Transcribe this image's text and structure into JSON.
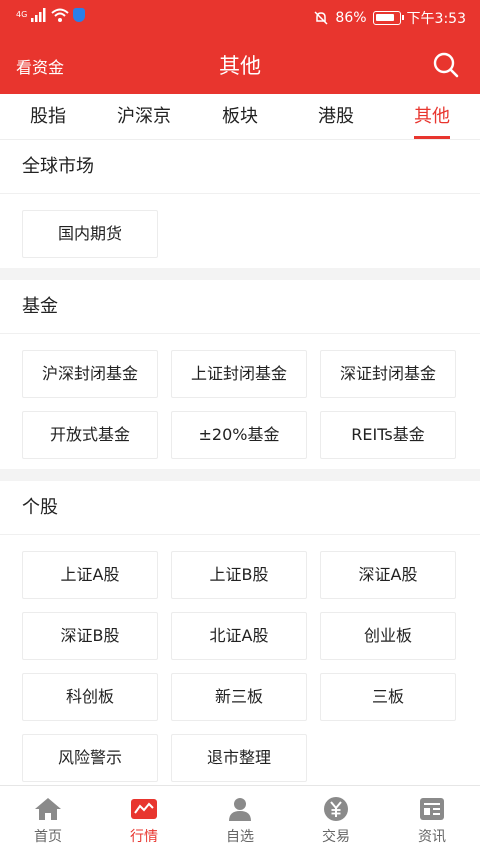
{
  "status": {
    "network": "4G",
    "battery": "86%",
    "time": "下午3:53"
  },
  "header": {
    "back_label": "看资金",
    "title": "其他"
  },
  "tabs": [
    {
      "label": "股指"
    },
    {
      "label": "沪深京"
    },
    {
      "label": "板块"
    },
    {
      "label": "港股"
    },
    {
      "label": "其他"
    }
  ],
  "sections": {
    "global": {
      "title": "全球市场",
      "items": [
        "国内期货"
      ]
    },
    "fund": {
      "title": "基金",
      "items": [
        "沪深封闭基金",
        "上证封闭基金",
        "深证封闭基金",
        "开放式基金",
        "±20%基金",
        "REITs基金"
      ]
    },
    "stock": {
      "title": "个股",
      "items": [
        "上证A股",
        "上证B股",
        "深证A股",
        "深证B股",
        "北证A股",
        "创业板",
        "科创板",
        "新三板",
        "三板",
        "风险警示",
        "退市整理"
      ]
    }
  },
  "bottom_nav": [
    {
      "label": "首页",
      "icon": "home-icon"
    },
    {
      "label": "行情",
      "icon": "market-icon"
    },
    {
      "label": "自选",
      "icon": "person-icon"
    },
    {
      "label": "交易",
      "icon": "yuan-icon"
    },
    {
      "label": "资讯",
      "icon": "news-icon"
    }
  ],
  "colors": {
    "accent": "#e8352e"
  }
}
